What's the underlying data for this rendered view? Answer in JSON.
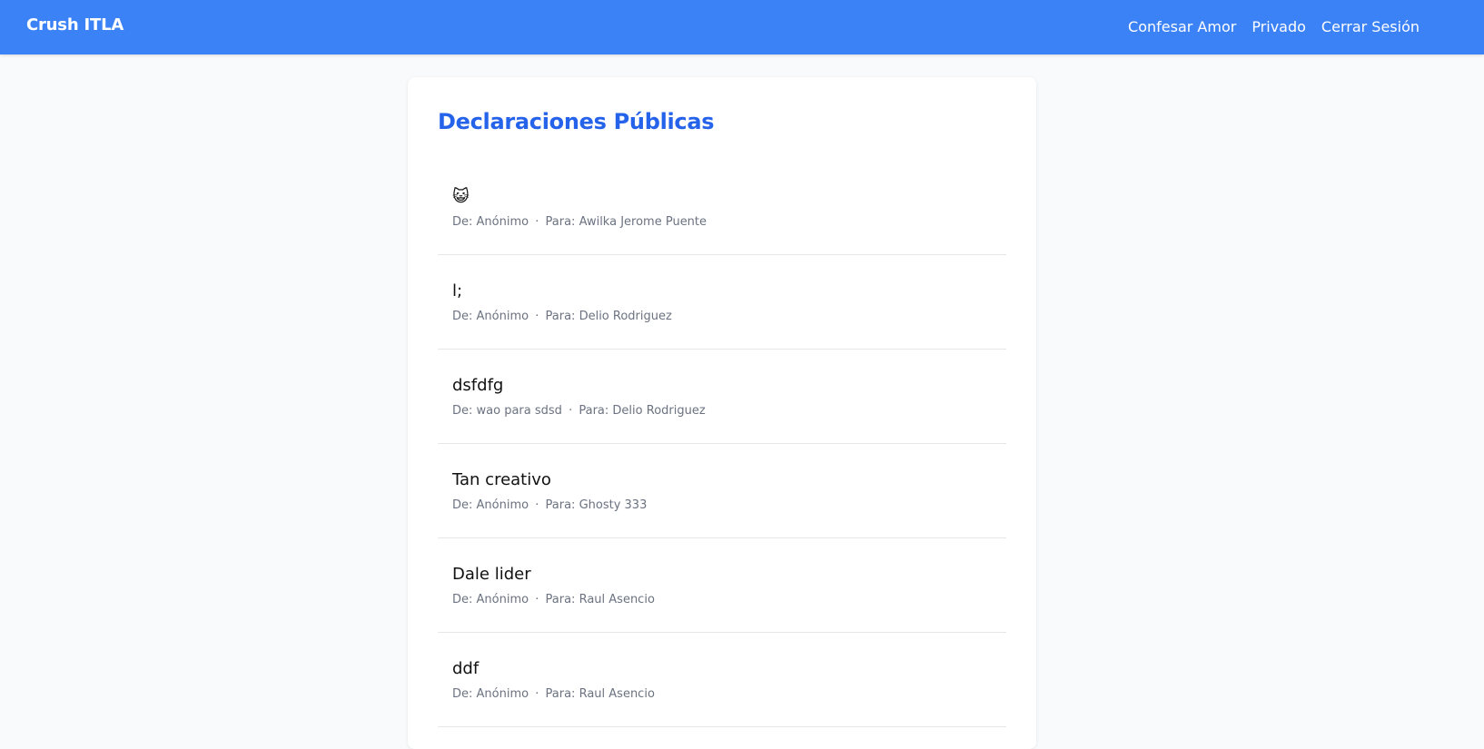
{
  "navbar": {
    "brand": "Crush ITLA",
    "links": [
      "Confesar Amor",
      "Privado",
      "Cerrar Sesión"
    ]
  },
  "main": {
    "title": "Declaraciones Públicas",
    "meta_labels": {
      "from": "De:",
      "to": "Para:",
      "separator": "·"
    },
    "items": [
      {
        "message": "😺",
        "from": "Anónimo",
        "to": "Awilka Jerome Puente"
      },
      {
        "message": "l;",
        "from": "Anónimo",
        "to": "Delio Rodriguez"
      },
      {
        "message": "dsfdfg",
        "from": "wao para sdsd",
        "to": "Delio Rodriguez"
      },
      {
        "message": "Tan creativo",
        "from": "Anónimo",
        "to": "Ghosty 333"
      },
      {
        "message": "Dale lider",
        "from": "Anónimo",
        "to": "Raul Asencio"
      },
      {
        "message": "ddf",
        "from": "Anónimo",
        "to": "Raul Asencio"
      }
    ]
  },
  "colors": {
    "navbar": "#3b82f6",
    "title": "#2563eb",
    "meta": "#6b7280",
    "background": "#f8fafc"
  }
}
